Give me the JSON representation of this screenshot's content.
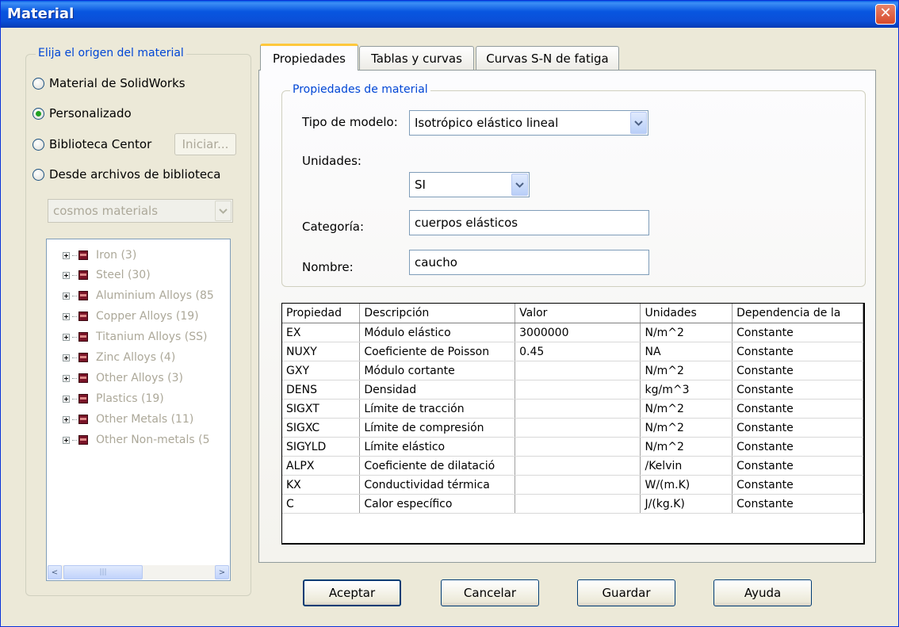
{
  "window": {
    "title": "Material",
    "close_glyph": "✕"
  },
  "source_group": {
    "legend": "Elija el origen del material",
    "options": [
      {
        "label": "Material de SolidWorks",
        "selected": false
      },
      {
        "label": "Personalizado",
        "selected": true
      },
      {
        "label": "Biblioteca Centor",
        "selected": false
      },
      {
        "label": "Desde archivos de biblioteca",
        "selected": false
      }
    ],
    "start_button": "Iniciar...",
    "library_combo": "cosmos materials",
    "tree_items": [
      "Iron (3)",
      "Steel (30)",
      "Aluminium Alloys (85",
      "Copper Alloys (19)",
      "Titanium Alloys (SS)",
      "Zinc Alloys (4)",
      "Other Alloys (3)",
      "Plastics (19)",
      "Other Metals (11)",
      "Other Non-metals (5"
    ],
    "scroll_left_glyph": "<",
    "scroll_right_glyph": ">",
    "scroll_grip_glyph": "|||"
  },
  "tabs": [
    {
      "label": "Propiedades",
      "active": true
    },
    {
      "label": "Tablas y curvas",
      "active": false
    },
    {
      "label": "Curvas S-N de fatiga",
      "active": false
    }
  ],
  "props_group": {
    "legend": "Propiedades de material",
    "model_type_label": "Tipo de modelo:",
    "model_type_value": "Isotrópico elástico lineal",
    "units_label": "Unidades:",
    "units_value": "SI",
    "category_label": "Categoría:",
    "category_value": "cuerpos elásticos",
    "name_label": "Nombre:",
    "name_value": "caucho"
  },
  "table": {
    "headers": [
      "Propiedad",
      "Descripción",
      "Valor",
      "Unidades",
      "Dependencia de la"
    ],
    "rows": [
      [
        "EX",
        "Módulo elástico",
        "3000000",
        "N/m^2",
        "Constante"
      ],
      [
        "NUXY",
        "Coeficiente de Poisson",
        "0.45",
        "NA",
        "Constante"
      ],
      [
        "GXY",
        "Módulo cortante",
        "",
        "N/m^2",
        "Constante"
      ],
      [
        "DENS",
        "Densidad",
        "",
        "kg/m^3",
        "Constante"
      ],
      [
        "SIGXT",
        "Límite de tracción",
        "",
        "N/m^2",
        "Constante"
      ],
      [
        "SIGXC",
        "Límite de compresión",
        "",
        "N/m^2",
        "Constante"
      ],
      [
        "SIGYLD",
        "Límite elástico",
        "",
        "N/m^2",
        "Constante"
      ],
      [
        "ALPX",
        "Coeficiente de dilatació",
        "",
        "/Kelvin",
        "Constante"
      ],
      [
        "KX",
        "Conductividad térmica",
        "",
        "W/(m.K)",
        "Constante"
      ],
      [
        "C",
        "Calor específico",
        "",
        "J/(kg.K)",
        "Constante"
      ]
    ]
  },
  "buttons": {
    "ok": "Aceptar",
    "cancel": "Cancelar",
    "save": "Guardar",
    "help": "Ayuda"
  },
  "colors": {
    "title_bar": "#0a55e0",
    "group_legend": "#0046d5",
    "close_button": "#d84a2a"
  }
}
